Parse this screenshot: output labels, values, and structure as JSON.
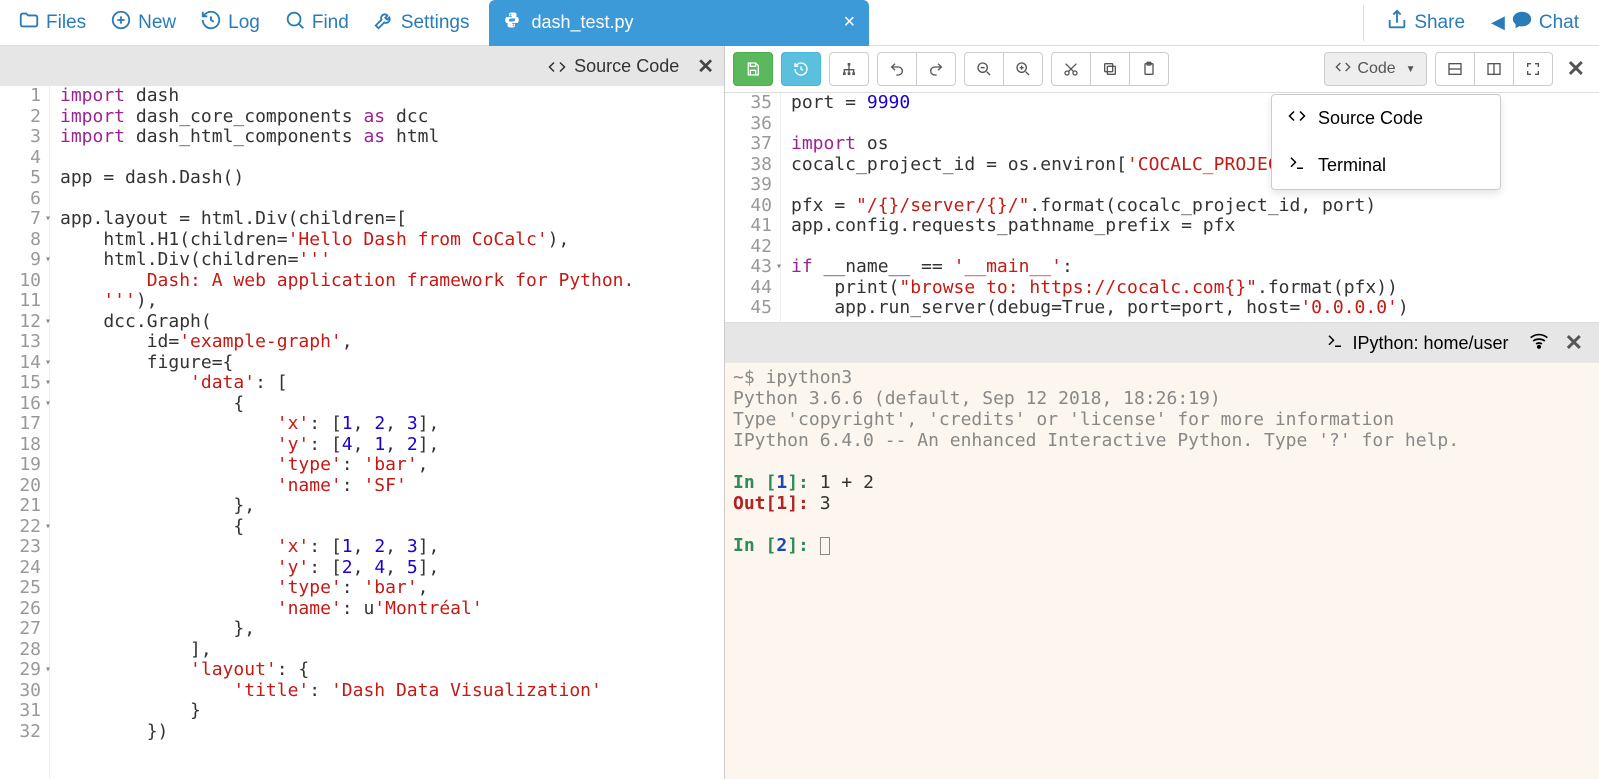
{
  "nav": {
    "files": "Files",
    "new": "New",
    "log": "Log",
    "find": "Find",
    "settings": "Settings"
  },
  "tab": {
    "filename": "dash_test.py"
  },
  "topright": {
    "share": "Share",
    "chat": "Chat"
  },
  "left_header": {
    "title": "Source Code"
  },
  "left_code": {
    "line_numbers": [
      "1",
      "2",
      "3",
      "4",
      "5",
      "6",
      "7",
      "8",
      "9",
      "10",
      "11",
      "12",
      "13",
      "14",
      "15",
      "16",
      "17",
      "18",
      "19",
      "20",
      "21",
      "22",
      "23",
      "24",
      "25",
      "26",
      "27",
      "28",
      "29",
      "30",
      "31",
      "32"
    ],
    "fold_lines": [
      "7",
      "9",
      "12",
      "14",
      "15",
      "16",
      "22",
      "29"
    ],
    "lines": [
      [
        {
          "c": "kw",
          "t": "import"
        },
        {
          "c": "",
          "t": " dash"
        }
      ],
      [
        {
          "c": "kw",
          "t": "import"
        },
        {
          "c": "",
          "t": " dash_core_components "
        },
        {
          "c": "kw",
          "t": "as"
        },
        {
          "c": "",
          "t": " dcc"
        }
      ],
      [
        {
          "c": "kw",
          "t": "import"
        },
        {
          "c": "",
          "t": " dash_html_components "
        },
        {
          "c": "kw",
          "t": "as"
        },
        {
          "c": "",
          "t": " html"
        }
      ],
      [],
      [
        {
          "c": "",
          "t": "app = dash.Dash()"
        }
      ],
      [],
      [
        {
          "c": "",
          "t": "app.layout = html.Div(children=["
        }
      ],
      [
        {
          "c": "",
          "t": "    html.H1(children="
        },
        {
          "c": "str",
          "t": "'Hello Dash from CoCalc'"
        },
        {
          "c": "",
          "t": "),"
        }
      ],
      [
        {
          "c": "",
          "t": "    html.Div(children="
        },
        {
          "c": "str",
          "t": "'''"
        }
      ],
      [
        {
          "c": "str",
          "t": "        Dash: A web application framework for Python."
        }
      ],
      [
        {
          "c": "str",
          "t": "    '''"
        },
        {
          "c": "",
          "t": "),"
        }
      ],
      [
        {
          "c": "",
          "t": "    dcc.Graph("
        }
      ],
      [
        {
          "c": "",
          "t": "        id="
        },
        {
          "c": "str",
          "t": "'example-graph'"
        },
        {
          "c": "",
          "t": ","
        }
      ],
      [
        {
          "c": "",
          "t": "        figure={"
        }
      ],
      [
        {
          "c": "",
          "t": "            "
        },
        {
          "c": "str",
          "t": "'data'"
        },
        {
          "c": "",
          "t": ": ["
        }
      ],
      [
        {
          "c": "",
          "t": "                {"
        }
      ],
      [
        {
          "c": "",
          "t": "                    "
        },
        {
          "c": "str",
          "t": "'x'"
        },
        {
          "c": "",
          "t": ": ["
        },
        {
          "c": "num",
          "t": "1"
        },
        {
          "c": "",
          "t": ", "
        },
        {
          "c": "num",
          "t": "2"
        },
        {
          "c": "",
          "t": ", "
        },
        {
          "c": "num",
          "t": "3"
        },
        {
          "c": "",
          "t": "],"
        }
      ],
      [
        {
          "c": "",
          "t": "                    "
        },
        {
          "c": "str",
          "t": "'y'"
        },
        {
          "c": "",
          "t": ": ["
        },
        {
          "c": "num",
          "t": "4"
        },
        {
          "c": "",
          "t": ", "
        },
        {
          "c": "num",
          "t": "1"
        },
        {
          "c": "",
          "t": ", "
        },
        {
          "c": "num",
          "t": "2"
        },
        {
          "c": "",
          "t": "],"
        }
      ],
      [
        {
          "c": "",
          "t": "                    "
        },
        {
          "c": "str",
          "t": "'type'"
        },
        {
          "c": "",
          "t": ": "
        },
        {
          "c": "str",
          "t": "'bar'"
        },
        {
          "c": "",
          "t": ","
        }
      ],
      [
        {
          "c": "",
          "t": "                    "
        },
        {
          "c": "str",
          "t": "'name'"
        },
        {
          "c": "",
          "t": ": "
        },
        {
          "c": "str",
          "t": "'SF'"
        }
      ],
      [
        {
          "c": "",
          "t": "                },"
        }
      ],
      [
        {
          "c": "",
          "t": "                {"
        }
      ],
      [
        {
          "c": "",
          "t": "                    "
        },
        {
          "c": "str",
          "t": "'x'"
        },
        {
          "c": "",
          "t": ": ["
        },
        {
          "c": "num",
          "t": "1"
        },
        {
          "c": "",
          "t": ", "
        },
        {
          "c": "num",
          "t": "2"
        },
        {
          "c": "",
          "t": ", "
        },
        {
          "c": "num",
          "t": "3"
        },
        {
          "c": "",
          "t": "],"
        }
      ],
      [
        {
          "c": "",
          "t": "                    "
        },
        {
          "c": "str",
          "t": "'y'"
        },
        {
          "c": "",
          "t": ": ["
        },
        {
          "c": "num",
          "t": "2"
        },
        {
          "c": "",
          "t": ", "
        },
        {
          "c": "num",
          "t": "4"
        },
        {
          "c": "",
          "t": ", "
        },
        {
          "c": "num",
          "t": "5"
        },
        {
          "c": "",
          "t": "],"
        }
      ],
      [
        {
          "c": "",
          "t": "                    "
        },
        {
          "c": "str",
          "t": "'type'"
        },
        {
          "c": "",
          "t": ": "
        },
        {
          "c": "str",
          "t": "'bar'"
        },
        {
          "c": "",
          "t": ","
        }
      ],
      [
        {
          "c": "",
          "t": "                    "
        },
        {
          "c": "str",
          "t": "'name'"
        },
        {
          "c": "",
          "t": ": u"
        },
        {
          "c": "str",
          "t": "'Montréal'"
        }
      ],
      [
        {
          "c": "",
          "t": "                },"
        }
      ],
      [
        {
          "c": "",
          "t": "            ],"
        }
      ],
      [
        {
          "c": "",
          "t": "            "
        },
        {
          "c": "str",
          "t": "'layout'"
        },
        {
          "c": "",
          "t": ": {"
        }
      ],
      [
        {
          "c": "",
          "t": "                "
        },
        {
          "c": "str",
          "t": "'title'"
        },
        {
          "c": "",
          "t": ": "
        },
        {
          "c": "str",
          "t": "'Dash Data Visualization'"
        }
      ],
      [
        {
          "c": "",
          "t": "            }"
        }
      ],
      [
        {
          "c": "",
          "t": "        })"
        }
      ]
    ]
  },
  "right_toolbar": {
    "code_label": "Code"
  },
  "dropdown": {
    "item1": "Source Code",
    "item2": "Terminal"
  },
  "right_code": {
    "line_numbers": [
      "35",
      "36",
      "37",
      "38",
      "39",
      "40",
      "41",
      "42",
      "43",
      "44",
      "45"
    ],
    "fold_lines": [
      "43"
    ],
    "lines": [
      [
        {
          "c": "",
          "t": "port = "
        },
        {
          "c": "num",
          "t": "9990"
        }
      ],
      [],
      [
        {
          "c": "kw",
          "t": "import"
        },
        {
          "c": "",
          "t": " os"
        }
      ],
      [
        {
          "c": "",
          "t": "cocalc_project_id = os.environ["
        },
        {
          "c": "str",
          "t": "'COCALC_PROJEC"
        }
      ],
      [],
      [
        {
          "c": "",
          "t": "pfx = "
        },
        {
          "c": "str",
          "t": "\"/{}/server/{}/\""
        },
        {
          "c": "",
          "t": ".format(cocalc_project_id, port)"
        }
      ],
      [
        {
          "c": "",
          "t": "app.config.requests_pathname_prefix = pfx"
        }
      ],
      [],
      [
        {
          "c": "kw",
          "t": "if"
        },
        {
          "c": "",
          "t": " __name__ == "
        },
        {
          "c": "str",
          "t": "'__main__'"
        },
        {
          "c": "",
          "t": ":"
        }
      ],
      [
        {
          "c": "",
          "t": "    print("
        },
        {
          "c": "str",
          "t": "\"browse to: https://cocalc.com{}\""
        },
        {
          "c": "",
          "t": ".format(pfx))"
        }
      ],
      [
        {
          "c": "",
          "t": "    app.run_server(debug=True, port=port, host="
        },
        {
          "c": "str",
          "t": "'0.0.0.0'"
        },
        {
          "c": "",
          "t": ")"
        }
      ]
    ]
  },
  "term_header": {
    "title": "IPython: home/user"
  },
  "terminal": {
    "l1": "~$ ipython3",
    "l2": "Python 3.6.6 (default, Sep 12 2018, 18:26:19)",
    "l3": "Type 'copyright', 'credits' or 'license' for more information",
    "l4": "IPython 6.4.0 -- An enhanced Interactive Python. Type '?' for help.",
    "in1_pre": "In [",
    "in1_num": "1",
    "in1_post": "]: ",
    "in1_body": "1 + 2",
    "out1_pre": "Out[",
    "out1_num": "1",
    "out1_post": "]: ",
    "out1_body": "3",
    "in2_pre": "In [",
    "in2_num": "2",
    "in2_post": "]: "
  }
}
